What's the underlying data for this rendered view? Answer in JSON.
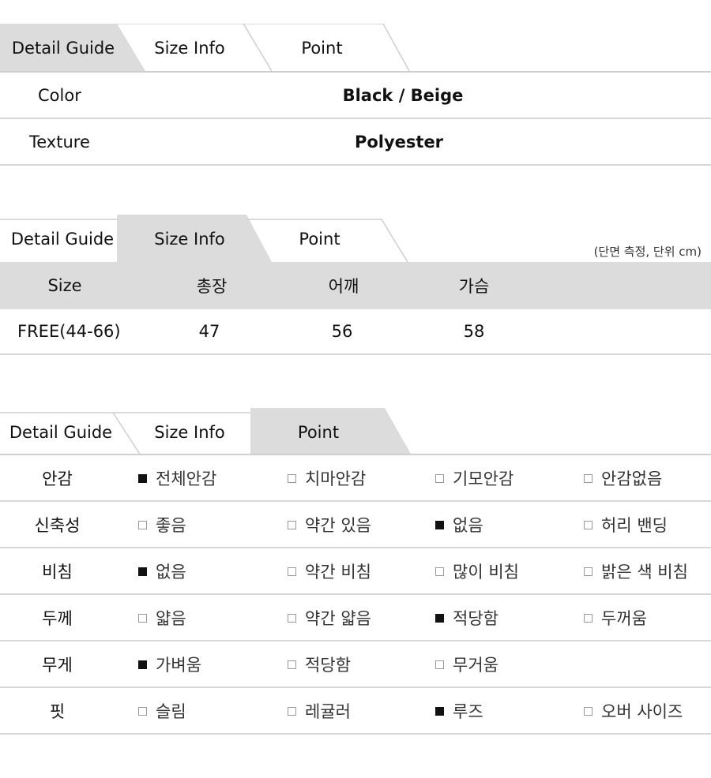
{
  "tabs": [
    "Detail Guide",
    "Size Info",
    "Point"
  ],
  "detail": {
    "rows": [
      {
        "label": "Color",
        "value": "Black / Beige"
      },
      {
        "label": "Texture",
        "value": "Polyester"
      }
    ]
  },
  "size_info": {
    "note": "(단면 측정, 단위 cm)",
    "headers": [
      "Size",
      "총장",
      "어깨",
      "가슴"
    ],
    "row": [
      "FREE(44-66)",
      "47",
      "56",
      "58"
    ]
  },
  "point": {
    "rows": [
      {
        "label": "안감",
        "options": [
          {
            "text": "전체안감",
            "checked": true
          },
          {
            "text": "치마안감",
            "checked": false
          },
          {
            "text": "기모안감",
            "checked": false
          },
          {
            "text": "안감없음",
            "checked": false
          }
        ]
      },
      {
        "label": "신축성",
        "options": [
          {
            "text": "좋음",
            "checked": false
          },
          {
            "text": "약간 있음",
            "checked": false
          },
          {
            "text": "없음",
            "checked": true
          },
          {
            "text": "허리 밴딩",
            "checked": false
          }
        ]
      },
      {
        "label": "비침",
        "options": [
          {
            "text": "없음",
            "checked": true
          },
          {
            "text": "약간 비침",
            "checked": false
          },
          {
            "text": "많이 비침",
            "checked": false
          },
          {
            "text": "밝은 색 비침",
            "checked": false
          }
        ]
      },
      {
        "label": "두께",
        "options": [
          {
            "text": "얇음",
            "checked": false
          },
          {
            "text": "약간 얇음",
            "checked": false
          },
          {
            "text": "적당함",
            "checked": true
          },
          {
            "text": "두꺼움",
            "checked": false
          }
        ]
      },
      {
        "label": "무게",
        "options": [
          {
            "text": "가벼움",
            "checked": true
          },
          {
            "text": "적당함",
            "checked": false
          },
          {
            "text": "무거움",
            "checked": false
          }
        ]
      },
      {
        "label": "핏",
        "options": [
          {
            "text": "슬림",
            "checked": false
          },
          {
            "text": "레귤러",
            "checked": false
          },
          {
            "text": "루즈",
            "checked": true
          },
          {
            "text": "오버 사이즈",
            "checked": false
          }
        ]
      }
    ]
  },
  "colors": {
    "active_tab": "#dcdcdc",
    "header_band": "#dcdcdc",
    "line": "#d7d7d7",
    "checked": "#111111",
    "unchecked_border": "#9a9a9a"
  }
}
